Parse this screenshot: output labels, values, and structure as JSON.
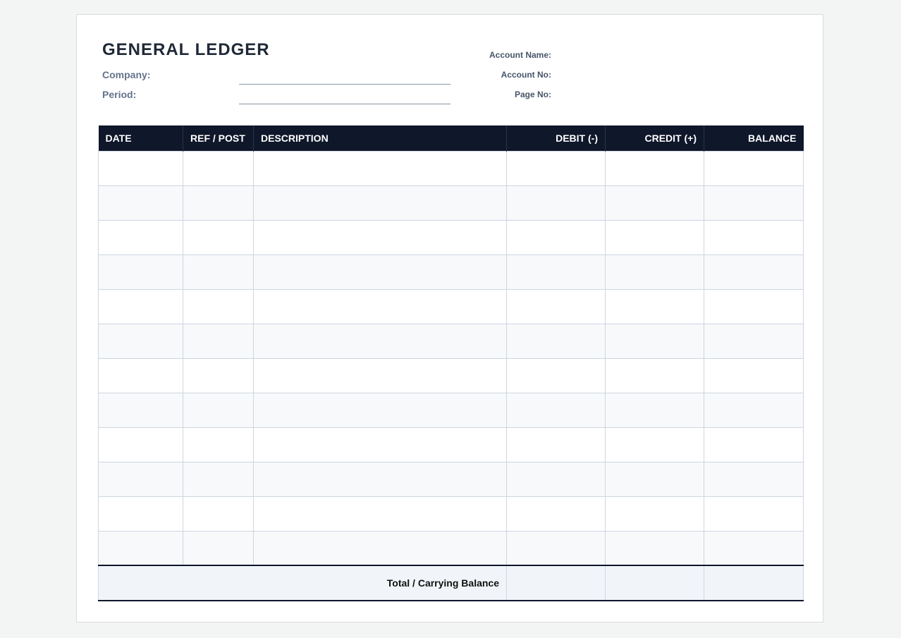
{
  "document": {
    "title": "GENERAL LEDGER",
    "fields": {
      "company_label": "Company:",
      "period_label": "Period:"
    },
    "account": {
      "name_label": "Account Name:",
      "number_label": "Account No:",
      "page_label": "Page No:"
    },
    "table": {
      "columns": [
        "DATE",
        "REF / POST",
        "DESCRIPTION",
        "DEBIT (-)",
        "CREDIT (+)",
        "BALANCE"
      ],
      "row_count": 12,
      "footer_label": "Total / Carrying Balance"
    }
  }
}
